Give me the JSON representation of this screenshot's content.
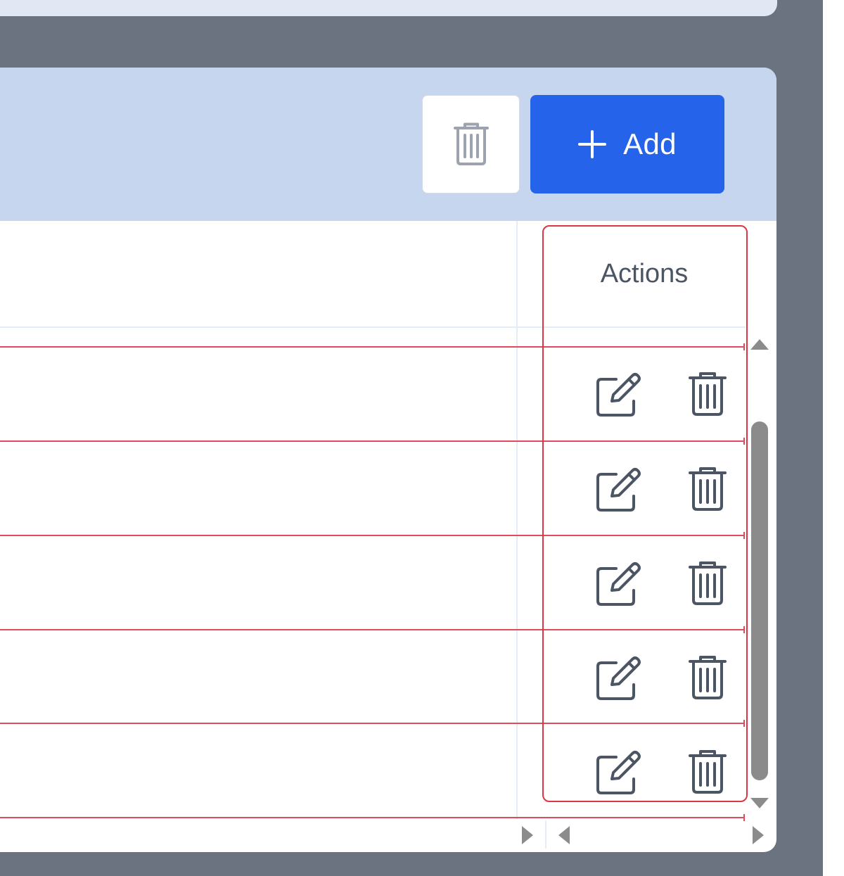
{
  "toolbar": {
    "delete_icon": "trash-icon",
    "add_icon": "plus-icon",
    "add_label": "Add",
    "add_color": "#2563eb",
    "toolbar_bg": "#c6d6ef"
  },
  "table": {
    "actions_header": "Actions",
    "rows": [
      {
        "edit_icon": "edit-icon",
        "delete_icon": "trash-icon"
      },
      {
        "edit_icon": "edit-icon",
        "delete_icon": "trash-icon"
      },
      {
        "edit_icon": "edit-icon",
        "delete_icon": "trash-icon"
      },
      {
        "edit_icon": "edit-icon",
        "delete_icon": "trash-icon"
      },
      {
        "edit_icon": "edit-icon",
        "delete_icon": "trash-icon"
      }
    ]
  },
  "highlight_color": "#dc3545",
  "scrollbar": {
    "vertical_up_icon": "arrow-up-icon",
    "vertical_down_icon": "arrow-down-icon",
    "horizontal_left_icon": "arrow-left-icon",
    "horizontal_right_icon": "arrow-right-icon"
  }
}
